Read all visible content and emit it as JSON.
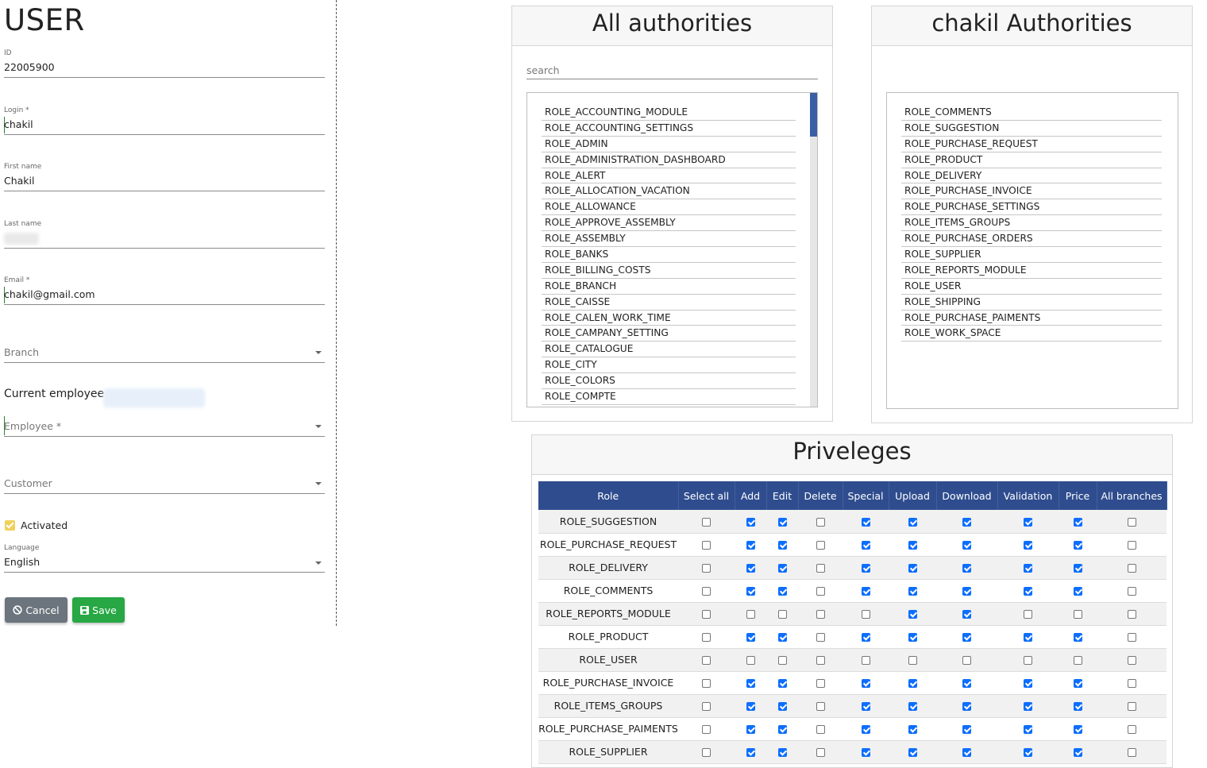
{
  "form": {
    "title": "USER",
    "id": {
      "label": "ID",
      "value": "22005900"
    },
    "login": {
      "label": "Login *",
      "value": "chakil"
    },
    "first_name": {
      "label": "First name",
      "value": "Chakil"
    },
    "last_name": {
      "label": "Last name",
      "value": ""
    },
    "email": {
      "label": "Email *",
      "value": "chakil@gmail.com"
    },
    "branch": {
      "placeholder": "Branch"
    },
    "current_employee_label": "Current employee",
    "employee": {
      "placeholder": "Employee  *"
    },
    "customer": {
      "placeholder": "Customer"
    },
    "activated": {
      "label": "Activated",
      "checked": true,
      "color": "#f0d15c"
    },
    "language": {
      "label": "Language",
      "value": "English"
    },
    "cancel_label": "Cancel",
    "save_label": "Save",
    "colors": {
      "cancel": "#6c757d",
      "save": "#28a745"
    }
  },
  "all_authorities": {
    "title": "All authorities",
    "search_placeholder": "search",
    "items": [
      "ROLE_ACCOUNTING_MODULE",
      "ROLE_ACCOUNTING_SETTINGS",
      "ROLE_ADMIN",
      "ROLE_ADMINISTRATION_DASHBOARD",
      "ROLE_ALERT",
      "ROLE_ALLOCATION_VACATION",
      "ROLE_ALLOWANCE",
      "ROLE_APPROVE_ASSEMBLY",
      "ROLE_ASSEMBLY",
      "ROLE_BANKS",
      "ROLE_BILLING_COSTS",
      "ROLE_BRANCH",
      "ROLE_CAISSE",
      "ROLE_CALEN_WORK_TIME",
      "ROLE_CAMPANY_SETTING",
      "ROLE_CATALOGUE",
      "ROLE_CITY",
      "ROLE_COLORS",
      "ROLE_COMPTE"
    ]
  },
  "user_authorities": {
    "title": "chakil Authorities",
    "items": [
      "ROLE_COMMENTS",
      "ROLE_SUGGESTION",
      "ROLE_PURCHASE_REQUEST",
      "ROLE_PRODUCT",
      "ROLE_DELIVERY",
      "ROLE_PURCHASE_INVOICE",
      "ROLE_PURCHASE_SETTINGS",
      "ROLE_ITEMS_GROUPS",
      "ROLE_PURCHASE_ORDERS",
      "ROLE_SUPPLIER",
      "ROLE_REPORTS_MODULE",
      "ROLE_USER",
      "ROLE_SHIPPING",
      "ROLE_PURCHASE_PAIMENTS",
      "ROLE_WORK_SPACE"
    ]
  },
  "privileges": {
    "title": "Priveleges",
    "header_color": "#2f4d8e",
    "columns": [
      "Role",
      "Select all",
      "Add",
      "Edit",
      "Delete",
      "Special",
      "Upload",
      "Download",
      "Validation",
      "Price",
      "All branches"
    ],
    "rows": [
      {
        "role": "ROLE_SUGGESTION",
        "checks": [
          false,
          true,
          true,
          false,
          true,
          true,
          true,
          true,
          true,
          false
        ]
      },
      {
        "role": "ROLE_PURCHASE_REQUEST",
        "checks": [
          false,
          true,
          true,
          false,
          true,
          true,
          true,
          true,
          true,
          false
        ]
      },
      {
        "role": "ROLE_DELIVERY",
        "checks": [
          false,
          true,
          true,
          false,
          true,
          true,
          true,
          true,
          true,
          false
        ]
      },
      {
        "role": "ROLE_COMMENTS",
        "checks": [
          false,
          true,
          true,
          false,
          true,
          true,
          true,
          true,
          true,
          false
        ]
      },
      {
        "role": "ROLE_REPORTS_MODULE",
        "checks": [
          false,
          false,
          false,
          false,
          false,
          true,
          true,
          false,
          false,
          false
        ]
      },
      {
        "role": "ROLE_PRODUCT",
        "checks": [
          false,
          true,
          true,
          false,
          true,
          true,
          true,
          true,
          true,
          false
        ]
      },
      {
        "role": "ROLE_USER",
        "checks": [
          false,
          false,
          false,
          false,
          false,
          false,
          false,
          false,
          false,
          false
        ]
      },
      {
        "role": "ROLE_PURCHASE_INVOICE",
        "checks": [
          false,
          true,
          true,
          false,
          true,
          true,
          true,
          true,
          true,
          false
        ]
      },
      {
        "role": "ROLE_ITEMS_GROUPS",
        "checks": [
          false,
          true,
          true,
          false,
          true,
          true,
          true,
          true,
          true,
          false
        ]
      },
      {
        "role": "ROLE_PURCHASE_PAIMENTS",
        "checks": [
          false,
          true,
          true,
          false,
          true,
          true,
          true,
          true,
          true,
          false
        ]
      },
      {
        "role": "ROLE_SUPPLIER",
        "checks": [
          false,
          true,
          true,
          false,
          true,
          true,
          true,
          true,
          true,
          false
        ]
      }
    ]
  }
}
